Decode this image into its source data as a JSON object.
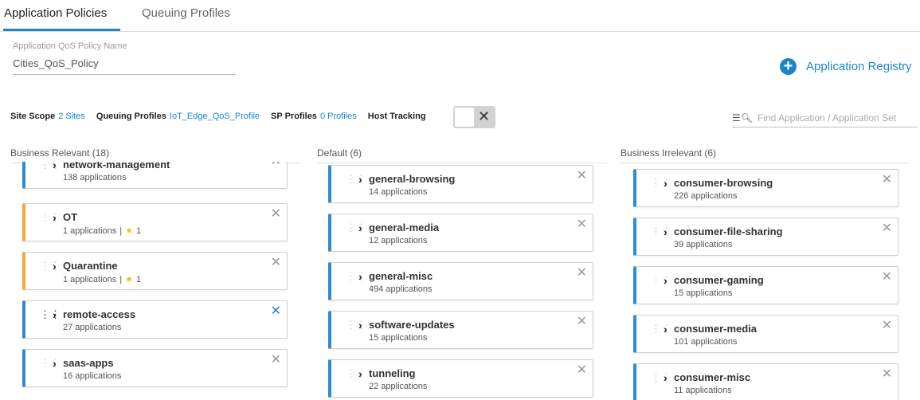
{
  "tabs": [
    {
      "label": "Application Policies",
      "active": true
    },
    {
      "label": "Queuing Profiles",
      "active": false
    }
  ],
  "policy": {
    "label": "Application QoS Policy Name",
    "value": "Cities_QoS_Policy"
  },
  "registry": {
    "label": "Application Registry",
    "icon": "plus-circle-icon"
  },
  "scope": {
    "site_scope_label": "Site Scope",
    "site_scope_value": "2 Sites",
    "queuing_label": "Queuing Profiles",
    "queuing_value": "IoT_Edge_QoS_Profile",
    "sp_label": "SP Profiles",
    "sp_value": "0 Profiles",
    "host_tracking_label": "Host Tracking",
    "host_tracking_enabled": false
  },
  "search": {
    "placeholder": "Find Application / Application Set",
    "icon": "filter-search-icon"
  },
  "colors": {
    "accent": "#1a86c8",
    "relevant_bar": "#2f8bd0",
    "custom_bar": "#f2a93b",
    "star": "#f2b922"
  },
  "columns": [
    {
      "header": "Business Relevant (18)",
      "cards": [
        {
          "name": "network-management",
          "count": "138 applications",
          "color": "blue"
        },
        {
          "name": "OT",
          "count": "1 applications",
          "star": "1",
          "color": "orange"
        },
        {
          "name": "Quarantine",
          "count": "1 applications",
          "star": "1",
          "color": "orange"
        },
        {
          "name": "remote-access",
          "count": "27 applications",
          "color": "blue",
          "hover": true
        },
        {
          "name": "saas-apps",
          "count": "16 applications",
          "color": "blue"
        }
      ]
    },
    {
      "header": "Default (6)",
      "cards": [
        {
          "name": "general-browsing",
          "count": "14 applications",
          "color": "blue"
        },
        {
          "name": "general-media",
          "count": "12 applications",
          "color": "blue"
        },
        {
          "name": "general-misc",
          "count": "494 applications",
          "color": "blue"
        },
        {
          "name": "software-updates",
          "count": "15 applications",
          "color": "blue"
        },
        {
          "name": "tunneling",
          "count": "22 applications",
          "color": "blue"
        }
      ]
    },
    {
      "header": "Business Irrelevant (6)",
      "cards": [
        {
          "name": "consumer-browsing",
          "count": "226 applications",
          "color": "blue"
        },
        {
          "name": "consumer-file-sharing",
          "count": "39 applications",
          "color": "blue"
        },
        {
          "name": "consumer-gaming",
          "count": "15 applications",
          "color": "blue"
        },
        {
          "name": "consumer-media",
          "count": "101 applications",
          "color": "blue"
        },
        {
          "name": "consumer-misc",
          "count": "11 applications",
          "color": "blue"
        }
      ]
    }
  ]
}
